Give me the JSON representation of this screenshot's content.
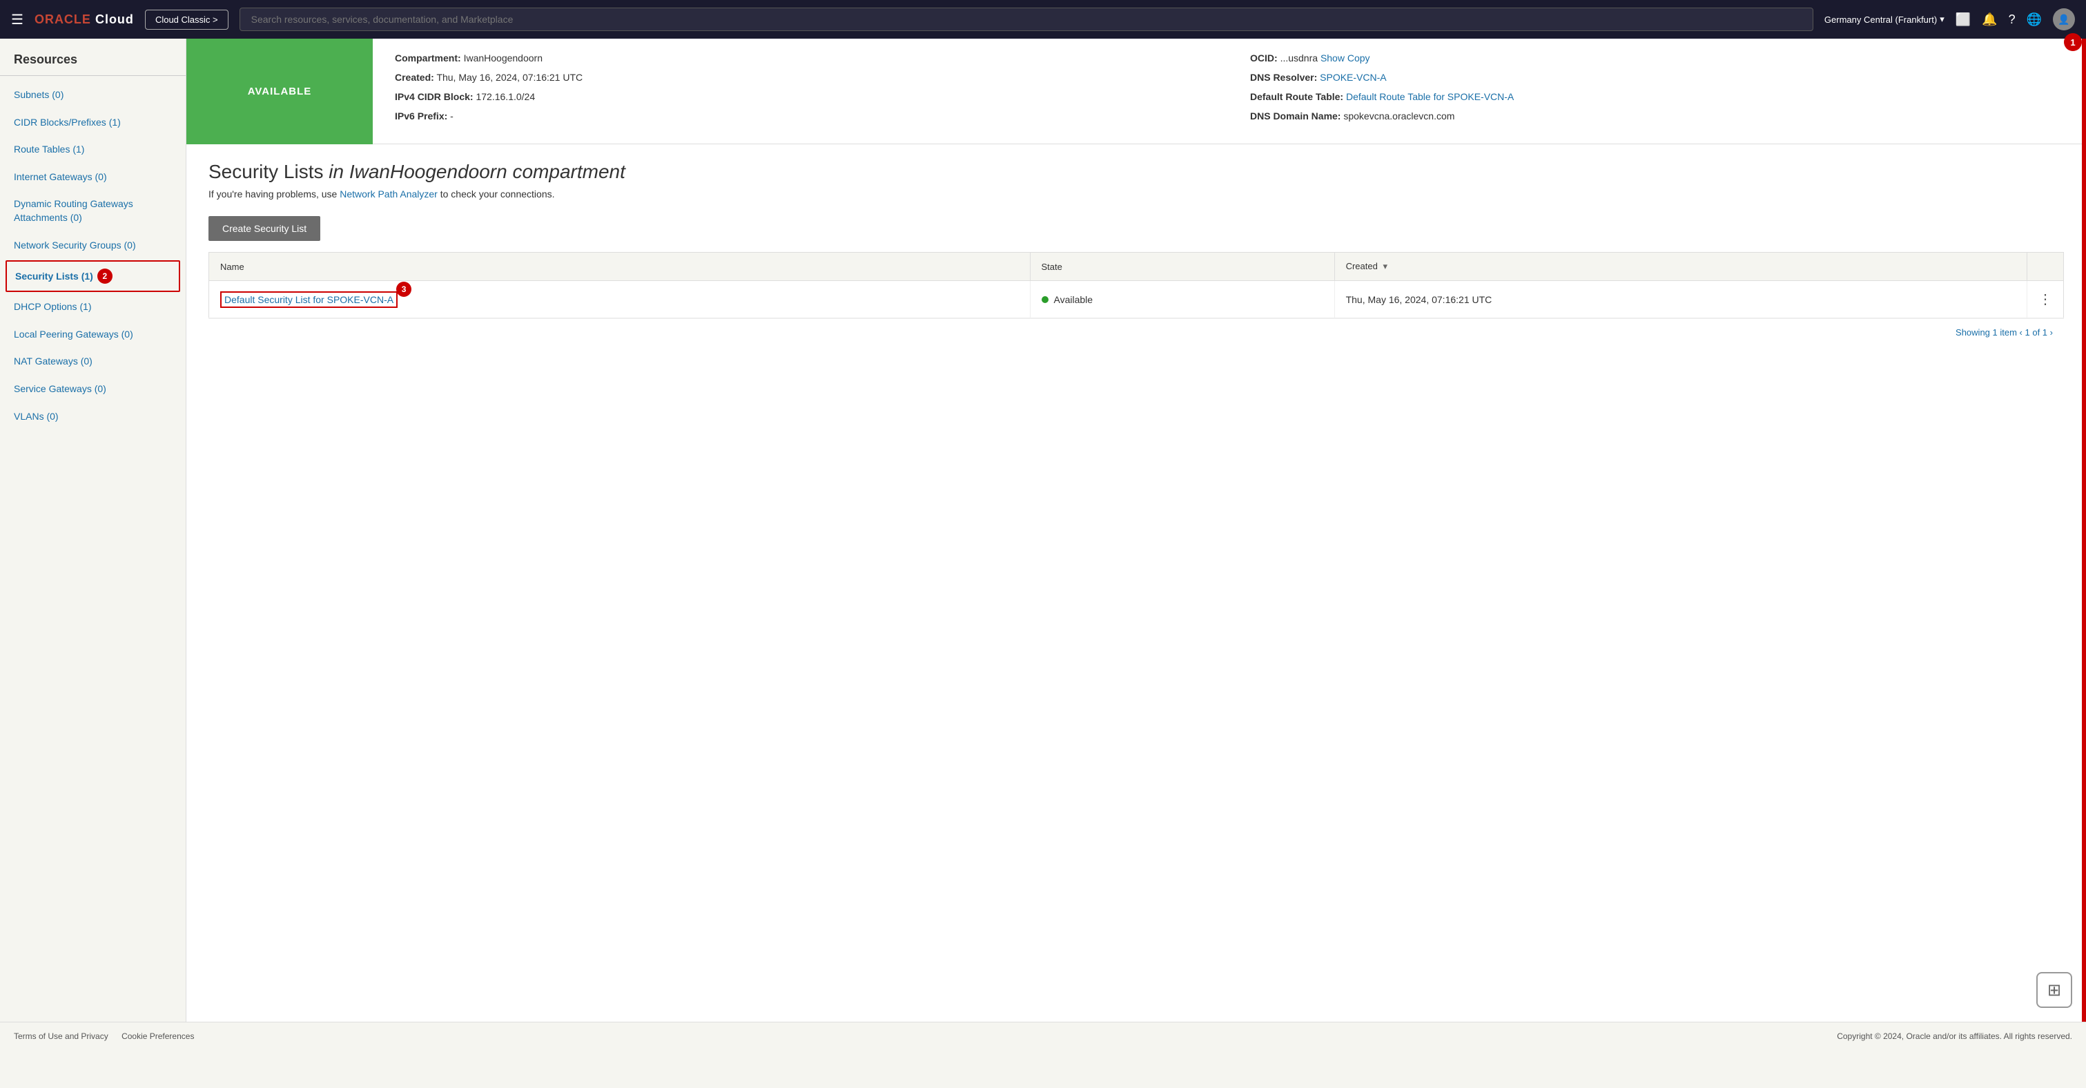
{
  "nav": {
    "hamburger": "☰",
    "logo": "ORACLE Cloud",
    "cloud_classic_btn": "Cloud Classic >",
    "search_placeholder": "Search resources, services, documentation, and Marketplace",
    "region": "Germany Central (Frankfurt)",
    "region_chevron": "▾"
  },
  "top_info": {
    "compartment_label": "Compartment:",
    "compartment_value": "IwanHoogendoorn",
    "created_label": "Created:",
    "created_value": "Thu, May 16, 2024, 07:16:21 UTC",
    "ipv4_label": "IPv4 CIDR Block:",
    "ipv4_value": "172.16.1.0/24",
    "ipv6_label": "IPv6 Prefix:",
    "ipv6_value": "-",
    "ocid_label": "OCID:",
    "ocid_value": "...usdnra",
    "show_link": "Show",
    "copy_link": "Copy",
    "dns_resolver_label": "DNS Resolver:",
    "dns_resolver_link": "SPOKE-VCN-A",
    "default_route_label": "Default Route Table:",
    "default_route_link": "Default Route Table for SPOKE-VCN-A",
    "dns_domain_label": "DNS Domain Name:",
    "dns_domain_value": "spokevcna.oraclevcn.com"
  },
  "available_banner": "AVAILABLE",
  "section": {
    "title_prefix": "Security Lists",
    "title_em": " in IwanHoogendoorn ",
    "title_suffix": "compartment",
    "subtext": "If you're having problems, use",
    "network_path_link": "Network Path Analyzer",
    "subtext_end": "to check your connections."
  },
  "table": {
    "create_btn": "Create Security List",
    "col_name": "Name",
    "col_state": "State",
    "col_created": "Created",
    "rows": [
      {
        "name": "Default Security List for SPOKE-VCN-A",
        "state": "Available",
        "created": "Thu, May 16, 2024, 07:16:21 UTC"
      }
    ],
    "pagination": "Showing 1 item",
    "page_info": "1 of 1"
  },
  "sidebar": {
    "title": "Resources",
    "items": [
      {
        "label": "Subnets (0)",
        "active": false
      },
      {
        "label": "CIDR Blocks/Prefixes (1)",
        "active": false
      },
      {
        "label": "Route Tables (1)",
        "active": false
      },
      {
        "label": "Internet Gateways (0)",
        "active": false
      },
      {
        "label": "Dynamic Routing Gateways Attachments (0)",
        "active": false
      },
      {
        "label": "Network Security Groups (0)",
        "active": false
      },
      {
        "label": "Security Lists (1)",
        "active": true
      },
      {
        "label": "DHCP Options (1)",
        "active": false
      },
      {
        "label": "Local Peering Gateways (0)",
        "active": false
      },
      {
        "label": "NAT Gateways (0)",
        "active": false
      },
      {
        "label": "Service Gateways (0)",
        "active": false
      },
      {
        "label": "VLANs (0)",
        "active": false
      }
    ]
  },
  "badges": {
    "top_right": "1",
    "sidebar_active": "2",
    "table_name": "3"
  },
  "footer": {
    "terms": "Terms of Use and Privacy",
    "cookie": "Cookie Preferences",
    "copyright": "Copyright © 2024, Oracle and/or its affiliates. All rights reserved."
  }
}
